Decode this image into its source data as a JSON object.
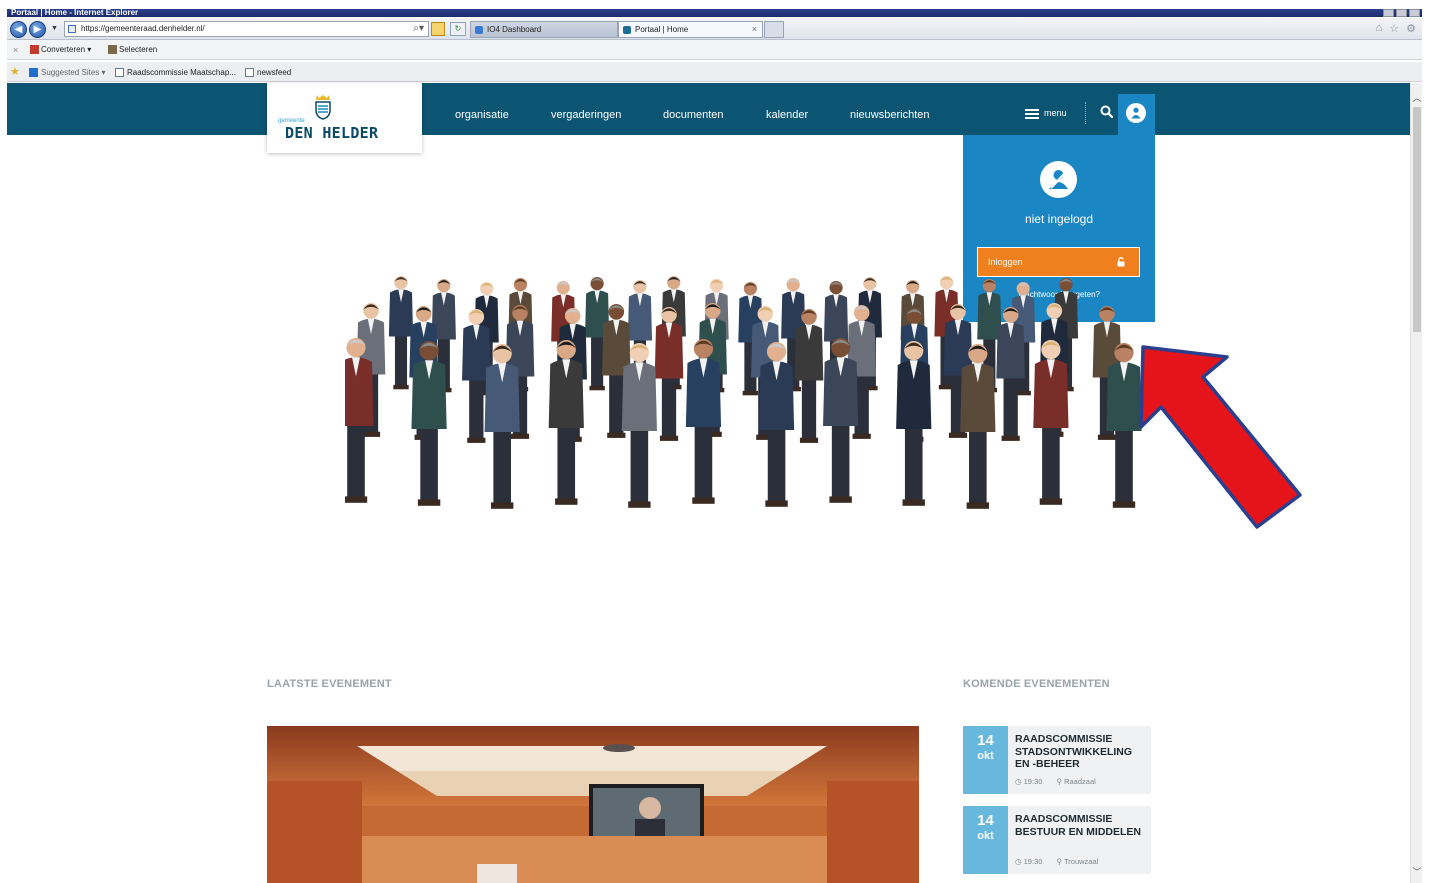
{
  "browser": {
    "window_title": "Portaal | Home - Internet Explorer",
    "url": "https://gemeenteraad.denhelder.nl/",
    "tabs": [
      {
        "label": "IO4 Dashboard",
        "active": false
      },
      {
        "label": "Portaal | Home",
        "active": true
      }
    ],
    "commandbar": {
      "convert_label": "Converteren",
      "select_label": "Selecteren"
    },
    "favorites": [
      {
        "label": "Suggested Sites ▾"
      },
      {
        "label": "Raadscommissie Maatschap..."
      },
      {
        "label": "newsfeed"
      }
    ]
  },
  "site": {
    "logo": {
      "small": "gemeente",
      "big": "DEN HELDER"
    },
    "nav": [
      "organisatie",
      "vergaderingen",
      "documenten",
      "kalender",
      "nieuwsberichten"
    ],
    "menu_label": "menu",
    "login": {
      "status": "niet ingelogd",
      "button_label": "Inloggen",
      "forgot_label": "Wachtwoord vergeten?"
    },
    "colors": {
      "header": "#0b5572",
      "accent_blue": "#1a86c4",
      "login_orange": "#f07f1e",
      "date_blue": "#67b8dc",
      "arrow_red": "#e5141a"
    }
  },
  "content": {
    "latest_event_title": "LAATSTE EVENEMENT",
    "upcoming_title": "KOMENDE EVENEMENTEN",
    "upcoming": [
      {
        "day": "14",
        "month": "okt",
        "title": "RAADSCOMMISSIE STADSONTWIKKELING EN -BEHEER",
        "time": "19:30",
        "location": "Raadzaal"
      },
      {
        "day": "14",
        "month": "okt",
        "title": "RAADSCOMMISSIE BESTUUR EN MIDDELEN",
        "time": "19:30",
        "location": "Trouwzaal"
      }
    ]
  }
}
